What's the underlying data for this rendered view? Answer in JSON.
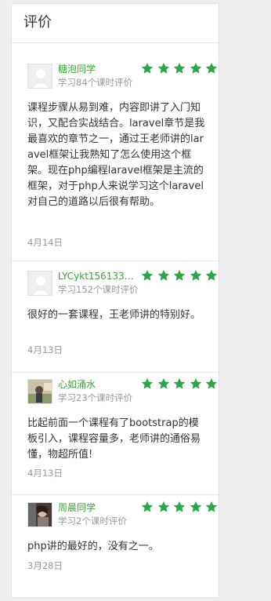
{
  "panel": {
    "title": "评价"
  },
  "colors": {
    "star": "#2ca54b",
    "username": "#3f9f3f",
    "meta": "#999999"
  },
  "reviews": [
    {
      "username": "糖泡同学",
      "meta": "学习84个课时评价",
      "rating": 5,
      "content": "课程步骤从易到难，内容即讲了入门知识，又配合实战结合。laravel章节是我最喜欢的章节之一，通过王老师讲的laravel框架让我熟知了怎么使用这个框架。现在php编程laravel框架是主流的框架，对于php人来说学习这个laravel对自己的道路以后很有帮助。",
      "date": "4月14日",
      "avatar": "default-avatar"
    },
    {
      "username": "LYCykt1561330...",
      "meta": "学习152个课时评价",
      "rating": 5,
      "content": "很好的一套课程，王老师讲的特别好。",
      "date": "4月13日",
      "avatar": "default-avatar"
    },
    {
      "username": "心如涌水",
      "meta": "学习23个课时评价",
      "rating": 5,
      "content": "比起前面一个课程有了bootstrap的模板引入，课程容量多，老师讲的通俗易懂，物超所值!",
      "date": "4月13日",
      "avatar": "photo-avatar"
    },
    {
      "username": "周晨同学",
      "meta": "学习2个课时评价",
      "rating": 5,
      "content": "php讲的最好的，没有之一。",
      "date": "3月28日",
      "avatar": "photo-avatar"
    }
  ]
}
